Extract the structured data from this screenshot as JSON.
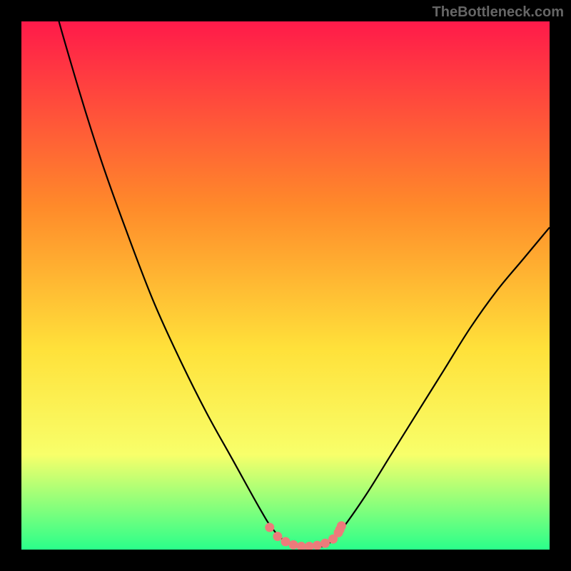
{
  "watermark": "TheBottleneck.com",
  "colors": {
    "frame_background": "#000000",
    "gradient_top": "#ff1a4a",
    "gradient_mid1": "#ff8a2a",
    "gradient_mid2": "#ffe13a",
    "gradient_mid3": "#f8ff6a",
    "gradient_bottom": "#2aff8a",
    "curve_stroke": "#000000",
    "marker_fill": "#ed7b7b",
    "watermark_text": "#666666"
  },
  "chart_data": {
    "type": "line",
    "title": "",
    "xlabel": "",
    "ylabel": "",
    "xlim": [
      0,
      100
    ],
    "ylim": [
      0,
      100
    ],
    "series": [
      {
        "name": "bottleneck-curve",
        "x": [
          0,
          5,
          10,
          15,
          20,
          25,
          30,
          35,
          40,
          45,
          47.5,
          50,
          52.5,
          55,
          57.5,
          60,
          65,
          70,
          75,
          80,
          85,
          90,
          95,
          100
        ],
        "values": [
          130,
          108,
          90,
          74,
          60,
          47,
          36,
          26,
          17,
          8,
          4,
          1.5,
          0.5,
          0.5,
          0.8,
          3,
          10,
          18,
          26,
          34,
          42,
          49,
          55,
          61
        ]
      }
    ],
    "markers": {
      "name": "highlight-points",
      "x": [
        47,
        48.5,
        50,
        51.5,
        53,
        54.5,
        56,
        57.5,
        59,
        60,
        60.3,
        60.6
      ],
      "y": [
        4.2,
        2.5,
        1.5,
        0.9,
        0.6,
        0.6,
        0.8,
        1.2,
        2.0,
        3.2,
        3.8,
        4.5
      ]
    },
    "background_gradient_stops": [
      {
        "offset": 0.0,
        "color": "#ff1a4a"
      },
      {
        "offset": 0.35,
        "color": "#ff8a2a"
      },
      {
        "offset": 0.62,
        "color": "#ffe13a"
      },
      {
        "offset": 0.82,
        "color": "#f8ff6a"
      },
      {
        "offset": 1.0,
        "color": "#2aff8a"
      }
    ]
  }
}
